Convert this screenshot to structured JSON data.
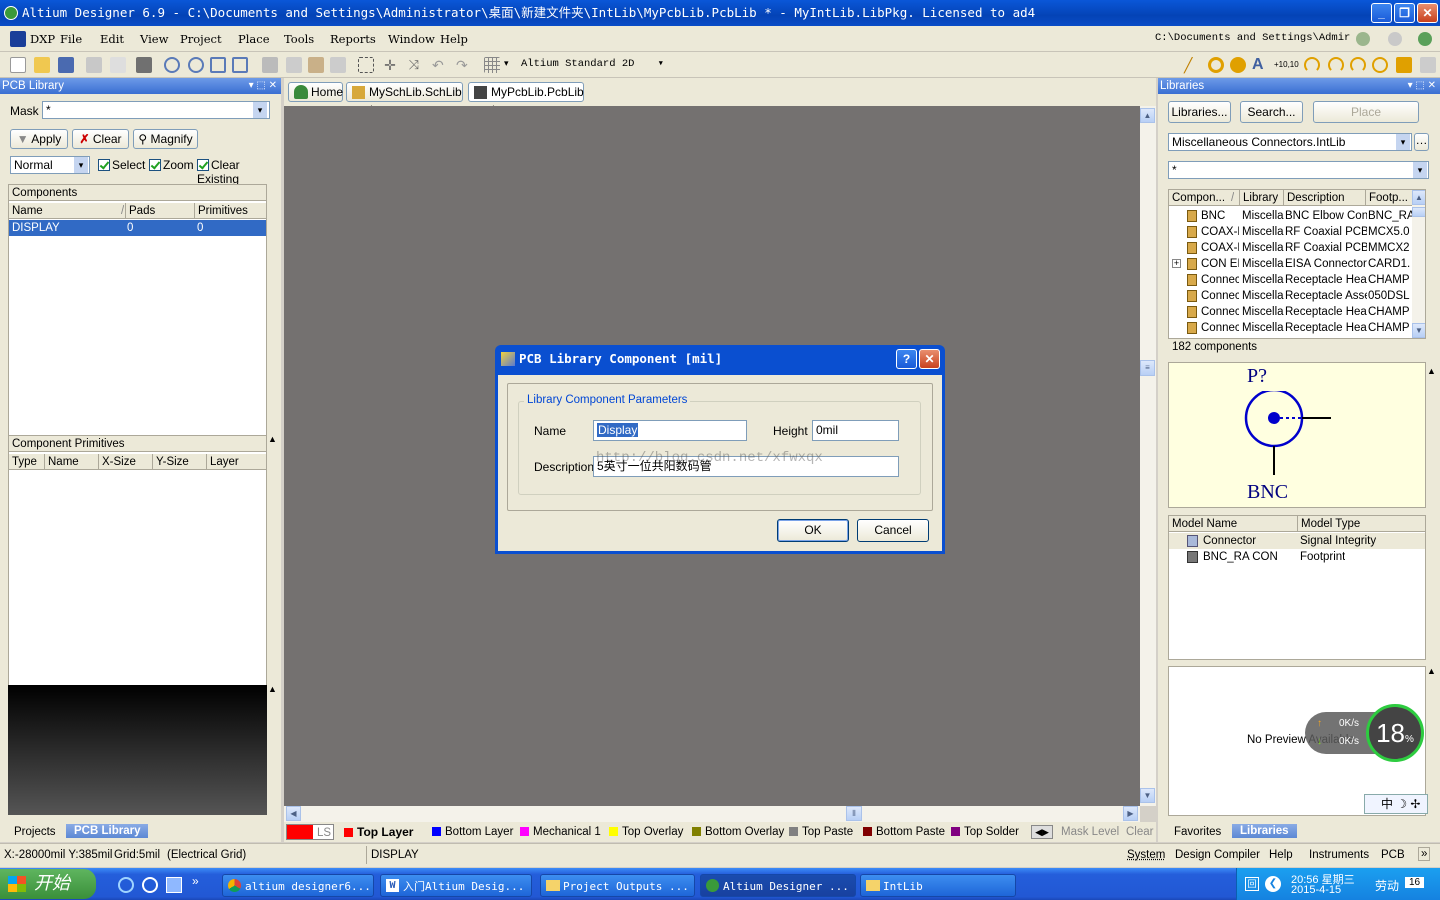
{
  "window": {
    "title": "Altium Designer 6.9 - C:\\Documents and Settings\\Administrator\\桌面\\新建文件夹\\IntLib\\MyPcbLib.PcbLib * - MyIntLib.LibPkg. Licensed to ad4"
  },
  "menu": [
    "DXP",
    "File",
    "Edit",
    "View",
    "Project",
    "Place",
    "Tools",
    "Reports",
    "Window",
    "Help"
  ],
  "menu_path": "C:\\Documents and Settings\\Admir",
  "toolbar": {
    "view_mode": "Altium Standard 2D"
  },
  "pcb_library_panel": {
    "title": "PCB Library",
    "mask_label": "Mask",
    "mask_value": "*",
    "apply": "Apply",
    "clear": "Clear",
    "magnify": "Magnify",
    "mode": "Normal",
    "select": "Select",
    "zoom": "Zoom",
    "clear_existing": "Clear Existing",
    "components_title": "Components",
    "columns": [
      "Name",
      "Pads",
      "Primitives"
    ],
    "rows": [
      {
        "name": "DISPLAY",
        "pads": "0",
        "primitives": "0"
      }
    ],
    "primitives_title": "Component Primitives",
    "primitive_columns": [
      "Type",
      "Name",
      "X-Size",
      "Y-Size",
      "Layer"
    ]
  },
  "tabs": [
    "Home",
    "MySchLib.SchLib *",
    "MyPcbLib.PcbLib *"
  ],
  "dialog": {
    "title": "PCB Library Component [mil]",
    "group_title": "Library Component Parameters",
    "name_label": "Name",
    "name_value": "Display",
    "height_label": "Height",
    "height_value": "0mil",
    "description_label": "Description",
    "description_value": "5英寸一位共阳数码管",
    "ok": "OK",
    "cancel": "Cancel",
    "watermark": "http://blog.csdn.net/xfwxqx"
  },
  "libraries_panel": {
    "title": "Libraries",
    "libraries_btn": "Libraries...",
    "search_btn": "Search...",
    "place_btn": "Place",
    "library_selected": "Miscellaneous Connectors.IntLib",
    "filter": "*",
    "columns": [
      "Compon...",
      "Library",
      "Description",
      "Footp..."
    ],
    "rows": [
      {
        "name": "BNC",
        "lib": "Miscella",
        "desc": "BNC Elbow Conn",
        "fp": "BNC_RA"
      },
      {
        "name": "COAX-F",
        "lib": "Miscella",
        "desc": "RF Coaxial PCB I",
        "fp": "MCX5.0"
      },
      {
        "name": "COAX-M",
        "lib": "Miscella",
        "desc": "RF Coaxial PCB I",
        "fp": "MMCX2"
      },
      {
        "name": "CON EI",
        "lib": "Miscella",
        "desc": "EISA Connector,",
        "fp": "CARD1."
      },
      {
        "name": "Connec",
        "lib": "Miscella",
        "desc": "Receptacle Hea",
        "fp": "CHAMP"
      },
      {
        "name": "Connec",
        "lib": "Miscella",
        "desc": "Receptacle Asse",
        "fp": "050DSL"
      },
      {
        "name": "Connec",
        "lib": "Miscella",
        "desc": "Receptacle Hea",
        "fp": "CHAMP"
      },
      {
        "name": "Connec",
        "lib": "Miscella",
        "desc": "Receptacle Hea",
        "fp": "CHAMP"
      }
    ],
    "count": "182 components",
    "symbol_designator": "P?",
    "symbol_name": "BNC",
    "model_columns": [
      "Model Name",
      "Model Type"
    ],
    "models": [
      {
        "name": "Connector",
        "type": "Signal Integrity"
      },
      {
        "name": "BNC_RA CON",
        "type": "Footprint"
      }
    ],
    "no_preview": "No Preview Available",
    "net_up": "0K/s",
    "net_down": "0K/s",
    "cpu_pct": "18",
    "pct_sign": "%"
  },
  "bottom_left_tabs": [
    "Projects",
    "PCB Library"
  ],
  "bottom_right_tabs": [
    "Favorites",
    "Libraries"
  ],
  "layers": [
    {
      "name": "LS",
      "color": "#ff0000"
    },
    {
      "name": "Top Layer",
      "color": "#ff0000"
    },
    {
      "name": "Bottom Layer",
      "color": "#0000ff"
    },
    {
      "name": "Mechanical 1",
      "color": "#ff00ff"
    },
    {
      "name": "Top Overlay",
      "color": "#ffff00"
    },
    {
      "name": "Bottom Overlay",
      "color": "#808000"
    },
    {
      "name": "Top Paste",
      "color": "#808080"
    },
    {
      "name": "Bottom Paste",
      "color": "#800000"
    },
    {
      "name": "Top Solder",
      "color": "#800080"
    }
  ],
  "layer_controls": {
    "mask_level": "Mask Level",
    "clear": "Clear"
  },
  "statusbar": {
    "coords": "X:-28000mil Y:385mil",
    "grid": "Grid:5mil",
    "electrical": "(Electrical Grid)",
    "component": "DISPLAY",
    "panels": [
      "System",
      "Design Compiler",
      "Help",
      "Instruments",
      "PCB"
    ]
  },
  "taskbar": {
    "start": "开始",
    "items": [
      "altium designer6...",
      "入门Altium Desig...",
      "Project Outputs ...",
      "Altium Designer ...",
      "IntLib"
    ],
    "time": "20:56 星期三",
    "date": "2015-4-15",
    "ime": "劳动",
    "num": "16"
  }
}
